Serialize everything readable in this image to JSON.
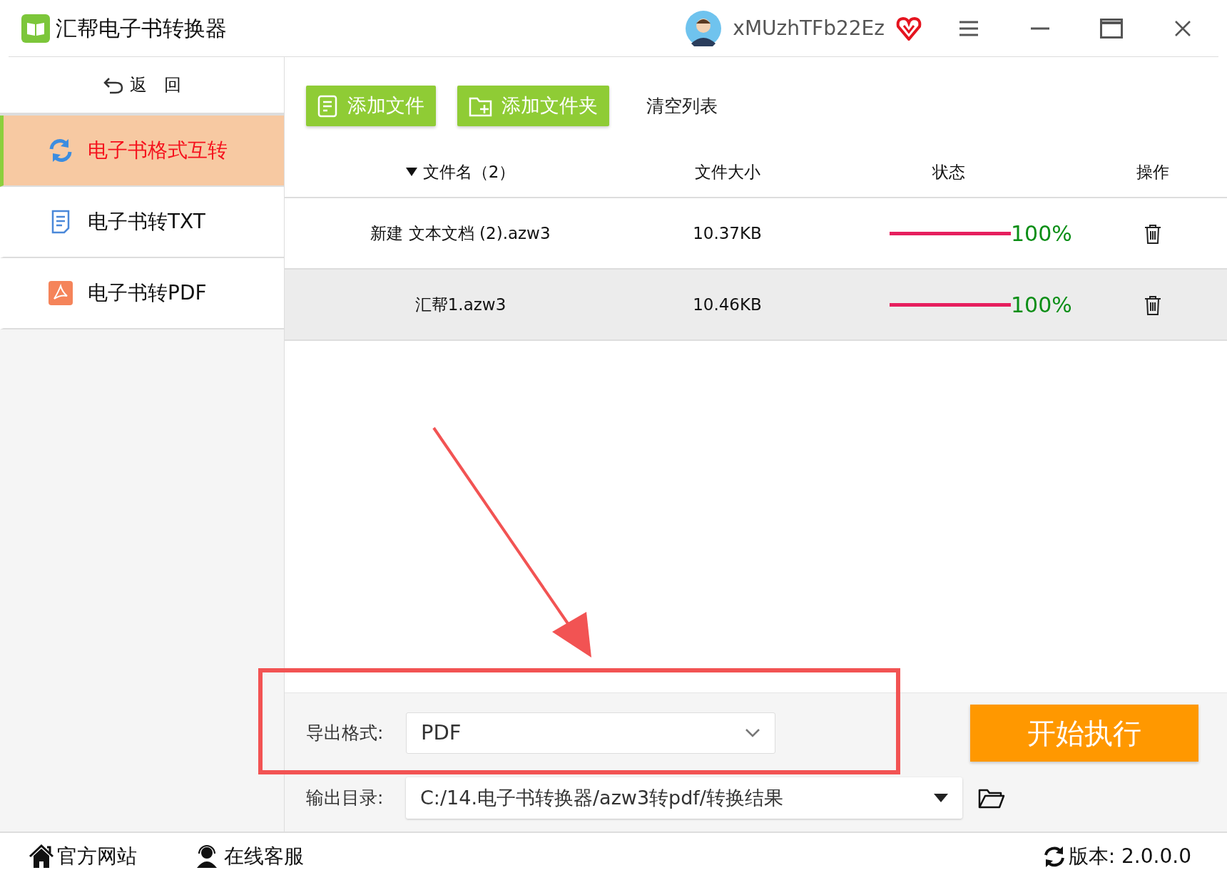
{
  "window": {
    "title": "汇帮电子书转换器",
    "user": "xMUzhTFb22Ez"
  },
  "sidebar": {
    "back": "返　回",
    "items": [
      {
        "kind": "convert",
        "label": "电子书格式互转",
        "selected": true
      },
      {
        "kind": "txt",
        "label": "电子书转TXT",
        "selected": false
      },
      {
        "kind": "pdf",
        "label": "电子书转PDF",
        "selected": false
      }
    ]
  },
  "toolbar": {
    "add_file": "添加文件",
    "add_folder": "添加文件夹",
    "clear": "清空列表"
  },
  "table": {
    "columns": [
      "文件名（2）",
      "文件大小",
      "状态",
      "操作"
    ],
    "rows": [
      {
        "name": "新建 文本文档 (2).azw3",
        "size": "10.37KB",
        "level": 1,
        "progress": "100%",
        "selected": false
      },
      {
        "name": "汇帮1.azw3",
        "size": "10.46KB",
        "level": 1,
        "progress": "100%",
        "selected": true
      }
    ]
  },
  "export_format": {
    "label": "导出格式:",
    "value": "PDF"
  },
  "output_dir": {
    "label": "输出目录:",
    "value": "C:/14.电子书转换器/azw3转pdf/转换结果"
  },
  "start_button": "开始执行",
  "footer": {
    "website": "官方网站",
    "support": "在线客服",
    "version": "版本: 2.0.0.0"
  }
}
